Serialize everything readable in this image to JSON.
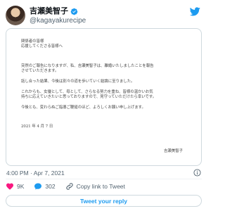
{
  "user": {
    "display_name": "吉瀬美智子",
    "handle": "@kagayakurecipe",
    "verified": true
  },
  "letter": {
    "salutation": [
      "関係者の皆様",
      "応援してくださる皆様へ"
    ],
    "paragraph1": [
      "突然のご報告になりますが、私、吉瀬美智子は、離婚いたしましたことを報告",
      "させていただきます。"
    ],
    "paragraph2": [
      "話し合った結果、今後は別々の道を歩いていく結論に至りました。"
    ],
    "paragraph3": [
      "これからも、女優として、母として、さらなる努力を重ね、皆様の温かいお気",
      "持ちに応えていきたいと思っておりますので、見守っていただけたら幸いです。"
    ],
    "paragraph4": [
      "今後とも、変わらぬご指導ご鞭撻のほど、よろしくお願い申し上げます。"
    ],
    "date": "2021 年 4 月 7 日",
    "signature": "吉瀬美智子"
  },
  "tweet": {
    "timestamp": "4:00 PM · Apr 7, 2021"
  },
  "actions": {
    "likes": "9K",
    "replies": "302",
    "copy_link_label": "Copy link to Tweet"
  },
  "reply_button_label": "Tweet your reply",
  "colors": {
    "accent": "#1d9bf0",
    "like": "#f91880",
    "muted": "#536471",
    "border": "#cfd9de"
  },
  "icons": [
    "verified-badge-icon",
    "twitter-bird-icon",
    "info-icon",
    "heart-icon",
    "reply-bubble-icon",
    "link-icon"
  ]
}
